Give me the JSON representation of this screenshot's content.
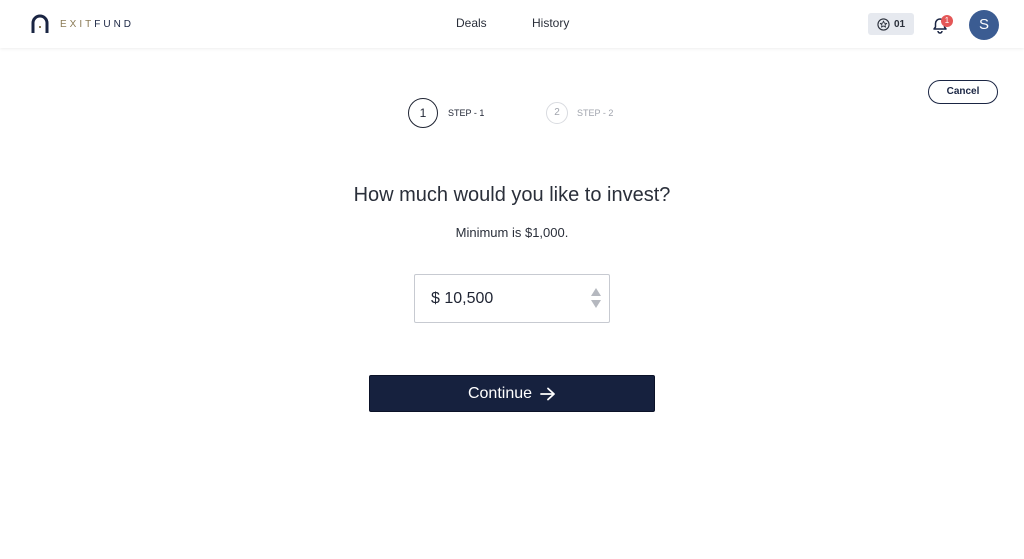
{
  "brand": {
    "exit": "EXIT",
    "fund": "FUND"
  },
  "nav": {
    "deals": "Deals",
    "history": "History"
  },
  "header": {
    "points": "01",
    "notification_count": "1",
    "avatar_initial": "S"
  },
  "actions": {
    "cancel": "Cancel",
    "continue": "Continue"
  },
  "steps": [
    {
      "number": "1",
      "label": "STEP - 1",
      "active": true
    },
    {
      "number": "2",
      "label": "STEP - 2",
      "active": false
    }
  ],
  "form": {
    "question": "How much would you like to invest?",
    "minimum_text": "Minimum is $1,000.",
    "amount_value": "$ 10,500"
  },
  "colors": {
    "primary": "#16213e",
    "avatar": "#3b5c92",
    "badge": "#e45757",
    "accent_gold": "#8a7a55"
  },
  "icons": [
    "logo-icon",
    "star-badge-icon",
    "bell-icon",
    "stepper-up-icon",
    "stepper-down-icon",
    "arrow-right-icon"
  ]
}
